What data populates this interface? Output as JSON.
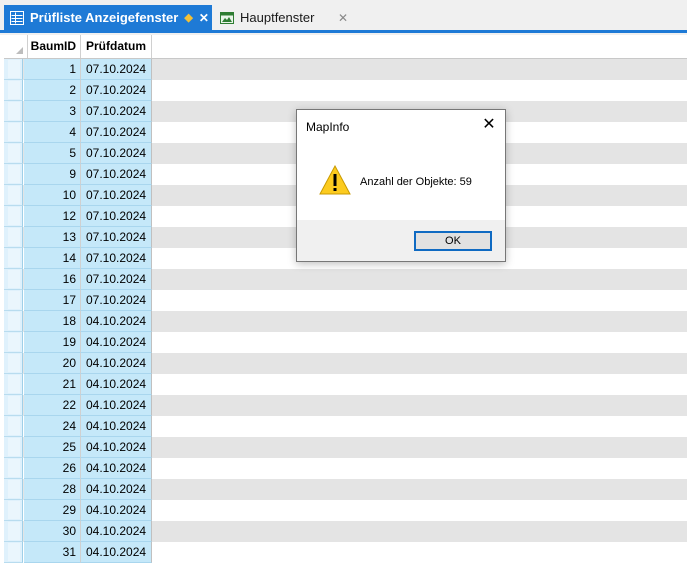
{
  "tabs": [
    {
      "label": "Prüfliste Anzeigefenster",
      "active": true,
      "icon": "table-icon",
      "pinned": true
    },
    {
      "label": "Hauptfenster",
      "active": false,
      "icon": "map-window-icon"
    }
  ],
  "colors": {
    "accent": "#1e7ad6",
    "selection": "#c5e8f9",
    "row_alt": "#e4e4e4",
    "pin": "#f2c037"
  },
  "table": {
    "columns": [
      "BaumID",
      "Prüfdatum"
    ],
    "rows": [
      [
        "1",
        "07.10.2024"
      ],
      [
        "2",
        "07.10.2024"
      ],
      [
        "3",
        "07.10.2024"
      ],
      [
        "4",
        "07.10.2024"
      ],
      [
        "5",
        "07.10.2024"
      ],
      [
        "9",
        "07.10.2024"
      ],
      [
        "10",
        "07.10.2024"
      ],
      [
        "12",
        "07.10.2024"
      ],
      [
        "13",
        "07.10.2024"
      ],
      [
        "14",
        "07.10.2024"
      ],
      [
        "16",
        "07.10.2024"
      ],
      [
        "17",
        "07.10.2024"
      ],
      [
        "18",
        "04.10.2024"
      ],
      [
        "19",
        "04.10.2024"
      ],
      [
        "20",
        "04.10.2024"
      ],
      [
        "21",
        "04.10.2024"
      ],
      [
        "22",
        "04.10.2024"
      ],
      [
        "24",
        "04.10.2024"
      ],
      [
        "25",
        "04.10.2024"
      ],
      [
        "26",
        "04.10.2024"
      ],
      [
        "28",
        "04.10.2024"
      ],
      [
        "29",
        "04.10.2024"
      ],
      [
        "30",
        "04.10.2024"
      ],
      [
        "31",
        "04.10.2024"
      ]
    ]
  },
  "dialog": {
    "title": "MapInfo",
    "message": "Anzahl der Objekte: 59",
    "ok_label": "OK",
    "icon": "warning-icon"
  }
}
